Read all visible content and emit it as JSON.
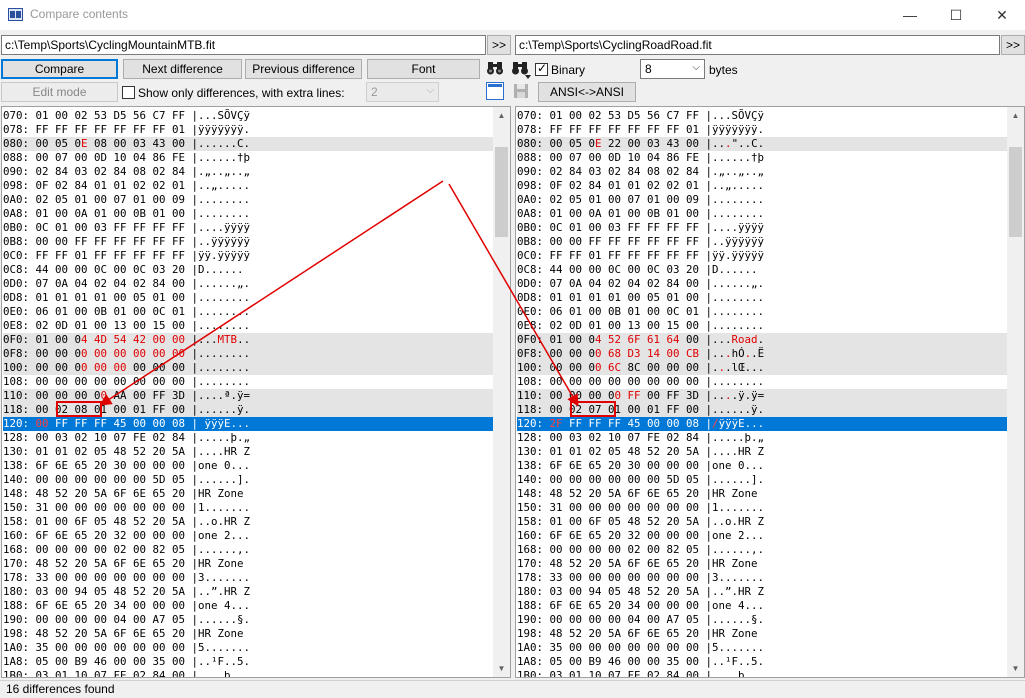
{
  "window": {
    "title": "Compare contents",
    "minimize_glyph": "—",
    "maximize_glyph": "☐",
    "close_glyph": "✕",
    "icon": "compare-app-icon"
  },
  "paths": {
    "left": "c:\\Temp\\Sports\\CyclingMountainMTB.fit",
    "right": "c:\\Temp\\Sports\\CyclingRoadRoad.fit",
    "browse_label": ">>"
  },
  "toolbar": {
    "compare_label": "Compare",
    "next_diff_label": "Next difference",
    "prev_diff_label": "Previous difference",
    "font_label": "Font",
    "find_icon": "binoculars-icon",
    "find_next_icon": "binoculars-next-icon",
    "binary_label": "Binary",
    "binary_checked": true,
    "bytes_value": "8",
    "bytes_label": "bytes",
    "edit_mode_label": "Edit mode",
    "show_only_label": "Show only differences, with extra lines:",
    "extra_lines_value": "2",
    "ansi_label": "ANSI<->ANSI",
    "window_icon": "window-icon",
    "save_icon": "save-icon"
  },
  "left_rows": [
    {
      "text": "070: 01 00 02 53 D5 56 C7 FF |...SÕVÇÿ",
      "state": "normal"
    },
    {
      "text": "078: FF FF FF FF FF FF FF 01 |ÿÿÿÿÿÿÿ.",
      "state": "normal"
    },
    {
      "text": "080: 00 05 0E 08 00 03 43 00 |......C.",
      "state": "diff",
      "red": [
        [
          12,
          14
        ]
      ]
    },
    {
      "text": "088: 00 07 00 0D 10 04 86 FE |......†þ",
      "state": "normal"
    },
    {
      "text": "090: 02 84 03 02 84 08 02 84 |.„..„..„",
      "state": "normal"
    },
    {
      "text": "098: 0F 02 84 01 01 02 02 01 |..„.....",
      "state": "normal"
    },
    {
      "text": "0A0: 02 05 01 00 07 01 00 09 |........",
      "state": "normal"
    },
    {
      "text": "0A8: 01 00 0A 01 00 0B 01 00 |........",
      "state": "normal"
    },
    {
      "text": "0B0: 0C 01 00 03 FF FF FF FF |....ÿÿÿÿ",
      "state": "normal"
    },
    {
      "text": "0B8: 00 00 FF FF FF FF FF FF |..ÿÿÿÿÿÿ",
      "state": "normal"
    },
    {
      "text": "0C0: FF FF 01 FF FF FF FF FF |ÿÿ.ÿÿÿÿÿ",
      "state": "normal"
    },
    {
      "text": "0C8: 44 00 00 0C 00 0C 03 20 |D...... ",
      "state": "normal"
    },
    {
      "text": "0D0: 07 0A 04 02 04 02 84 00 |......„.",
      "state": "normal"
    },
    {
      "text": "0D8: 01 01 01 01 00 05 01 00 |........",
      "state": "normal"
    },
    {
      "text": "0E0: 06 01 00 0B 01 00 0C 01 |........",
      "state": "normal"
    },
    {
      "text": "0E8: 02 0D 01 00 13 00 15 00 |........",
      "state": "normal"
    },
    {
      "text": "0F0: 01 00 04 4D 54 42 00 00 |...MTB..",
      "state": "diff",
      "red": [
        [
          12,
          29
        ],
        [
          33,
          36
        ]
      ]
    },
    {
      "text": "0F8: 00 00 00 00 00 00 00 00 |........",
      "state": "diff",
      "red": [
        [
          12,
          29
        ]
      ]
    },
    {
      "text": "100: 00 00 00 00 00 00 00 00 |........",
      "state": "diff",
      "red": [
        [
          12,
          20
        ]
      ]
    },
    {
      "text": "108: 00 00 00 00 00 00 00 00 |........",
      "state": "normal"
    },
    {
      "text": "110: 00 00 00 00 AA 00 FF 3D |....ª.ÿ=",
      "state": "diff",
      "red": [
        [
          15,
          17
        ]
      ]
    },
    {
      "text": "118: 00 02 08 01 00 01 FF 00 |......ÿ.",
      "state": "diff"
    },
    {
      "text": "120: 00 FF FF FF 45 00 00 08 | ÿÿÿE...",
      "state": "selected",
      "red": [
        [
          5,
          7
        ]
      ]
    },
    {
      "text": "128: 00 03 02 10 07 FE 02 84 |.....þ.„",
      "state": "normal"
    },
    {
      "text": "130: 01 01 02 05 48 52 20 5A |....HR Z",
      "state": "normal"
    },
    {
      "text": "138: 6F 6E 65 20 30 00 00 00 |one 0...",
      "state": "normal"
    },
    {
      "text": "140: 00 00 00 00 00 00 5D 05 |......].",
      "state": "normal"
    },
    {
      "text": "148: 48 52 20 5A 6F 6E 65 20 |HR Zone ",
      "state": "normal"
    },
    {
      "text": "150: 31 00 00 00 00 00 00 00 |1.......",
      "state": "normal"
    },
    {
      "text": "158: 01 00 6F 05 48 52 20 5A |..o.HR Z",
      "state": "normal"
    },
    {
      "text": "160: 6F 6E 65 20 32 00 00 00 |one 2...",
      "state": "normal"
    },
    {
      "text": "168: 00 00 00 00 02 00 82 05 |......‚.",
      "state": "normal"
    },
    {
      "text": "170: 48 52 20 5A 6F 6E 65 20 |HR Zone ",
      "state": "normal"
    },
    {
      "text": "178: 33 00 00 00 00 00 00 00 |3.......",
      "state": "normal"
    },
    {
      "text": "180: 03 00 94 05 48 52 20 5A |..”.HR Z",
      "state": "normal"
    },
    {
      "text": "188: 6F 6E 65 20 34 00 00 00 |one 4...",
      "state": "normal"
    },
    {
      "text": "190: 00 00 00 00 04 00 A7 05 |......§.",
      "state": "normal"
    },
    {
      "text": "198: 48 52 20 5A 6F 6E 65 20 |HR Zone ",
      "state": "normal"
    },
    {
      "text": "1A0: 35 00 00 00 00 00 00 00 |5.......",
      "state": "normal"
    },
    {
      "text": "1A8: 05 00 B9 46 00 00 35 00 |..¹F..5.",
      "state": "normal"
    },
    {
      "text": "1B0: 03 01 10 07 FE 02 84 00 |....þ.„.",
      "state": "normal"
    }
  ],
  "right_rows": [
    {
      "text": "070: 01 00 02 53 D5 56 C7 FF |...SÕVÇÿ",
      "state": "normal"
    },
    {
      "text": "078: FF FF FF FF FF FF FF 01 |ÿÿÿÿÿÿÿ.",
      "state": "normal"
    },
    {
      "text": "080: 00 05 0E 22 00 03 43 00 |...\"..C.",
      "state": "diff",
      "red": [
        [
          12,
          14
        ],
        [
          32,
          33
        ]
      ]
    },
    {
      "text": "088: 00 07 00 0D 10 04 86 FE |......†þ",
      "state": "normal"
    },
    {
      "text": "090: 02 84 03 02 84 08 02 84 |.„..„..„",
      "state": "normal"
    },
    {
      "text": "098: 0F 02 84 01 01 02 02 01 |..„.....",
      "state": "normal"
    },
    {
      "text": "0A0: 02 05 01 00 07 01 00 09 |........",
      "state": "normal"
    },
    {
      "text": "0A8: 01 00 0A 01 00 0B 01 00 |........",
      "state": "normal"
    },
    {
      "text": "0B0: 0C 01 00 03 FF FF FF FF |....ÿÿÿÿ",
      "state": "normal"
    },
    {
      "text": "0B8: 00 00 FF FF FF FF FF FF |..ÿÿÿÿÿÿ",
      "state": "normal"
    },
    {
      "text": "0C0: FF FF 01 FF FF FF FF FF |ÿÿ.ÿÿÿÿÿ",
      "state": "normal"
    },
    {
      "text": "0C8: 44 00 00 0C 00 0C 03 20 |D...... ",
      "state": "normal"
    },
    {
      "text": "0D0: 07 0A 04 02 04 02 84 00 |......„.",
      "state": "normal"
    },
    {
      "text": "0D8: 01 01 01 01 00 05 01 00 |........",
      "state": "normal"
    },
    {
      "text": "0E0: 06 01 00 0B 01 00 0C 01 |........",
      "state": "normal"
    },
    {
      "text": "0E8: 02 0D 01 00 13 00 15 00 |........",
      "state": "normal"
    },
    {
      "text": "0F0: 01 00 04 52 6F 61 64 00 |...Road.",
      "state": "diff",
      "red": [
        [
          12,
          26
        ],
        [
          33,
          37
        ]
      ]
    },
    {
      "text": "0F8: 00 00 00 68 D3 14 00 CB |...hÓ..Ë",
      "state": "diff",
      "red": [
        [
          12,
          29
        ],
        [
          32,
          33
        ],
        [
          35,
          36
        ]
      ]
    },
    {
      "text": "100: 00 00 00 6C 8C 00 00 00 |...lŒ...",
      "state": "diff",
      "red": [
        [
          12,
          17
        ],
        [
          31,
          32
        ]
      ]
    },
    {
      "text": "108: 00 00 00 00 00 00 00 00 |........",
      "state": "normal"
    },
    {
      "text": "110: 00 00 00 00 FF 00 FF 3D |....ÿ.ÿ=",
      "state": "diff",
      "red": [
        [
          15,
          20
        ],
        [
          32,
          33
        ]
      ]
    },
    {
      "text": "118: 00 02 07 01 00 01 FF 00 |......ÿ.",
      "state": "diff"
    },
    {
      "text": "120: 2F FF FF FF 45 00 00 08 |/ÿÿÿE...",
      "state": "selected",
      "red": [
        [
          5,
          7
        ],
        [
          30,
          31
        ]
      ]
    },
    {
      "text": "128: 00 03 02 10 07 FE 02 84 |.....þ.„",
      "state": "normal"
    },
    {
      "text": "130: 01 01 02 05 48 52 20 5A |....HR Z",
      "state": "normal"
    },
    {
      "text": "138: 6F 6E 65 20 30 00 00 00 |one 0...",
      "state": "normal"
    },
    {
      "text": "140: 00 00 00 00 00 00 5D 05 |......].",
      "state": "normal"
    },
    {
      "text": "148: 48 52 20 5A 6F 6E 65 20 |HR Zone ",
      "state": "normal"
    },
    {
      "text": "150: 31 00 00 00 00 00 00 00 |1.......",
      "state": "normal"
    },
    {
      "text": "158: 01 00 6F 05 48 52 20 5A |..o.HR Z",
      "state": "normal"
    },
    {
      "text": "160: 6F 6E 65 20 32 00 00 00 |one 2...",
      "state": "normal"
    },
    {
      "text": "168: 00 00 00 00 02 00 82 05 |......‚.",
      "state": "normal"
    },
    {
      "text": "170: 48 52 20 5A 6F 6E 65 20 |HR Zone ",
      "state": "normal"
    },
    {
      "text": "178: 33 00 00 00 00 00 00 00 |3.......",
      "state": "normal"
    },
    {
      "text": "180: 03 00 94 05 48 52 20 5A |..”.HR Z",
      "state": "normal"
    },
    {
      "text": "188: 6F 6E 65 20 34 00 00 00 |one 4...",
      "state": "normal"
    },
    {
      "text": "190: 00 00 00 00 04 00 A7 05 |......§.",
      "state": "normal"
    },
    {
      "text": "198: 48 52 20 5A 6F 6E 65 20 |HR Zone ",
      "state": "normal"
    },
    {
      "text": "1A0: 35 00 00 00 00 00 00 00 |5.......",
      "state": "normal"
    },
    {
      "text": "1A8: 05 00 B9 46 00 00 35 00 |..¹F..5.",
      "state": "normal"
    },
    {
      "text": "1B0: 03 01 10 07 FE 02 84 00 |....þ.„.",
      "state": "normal"
    }
  ],
  "status": {
    "text": "16 differences found"
  },
  "colors": {
    "diff_text": "#e00000",
    "selection": "#0078d7",
    "diff_row_bg": "#e4e4e4",
    "annotation": "#e00000"
  }
}
